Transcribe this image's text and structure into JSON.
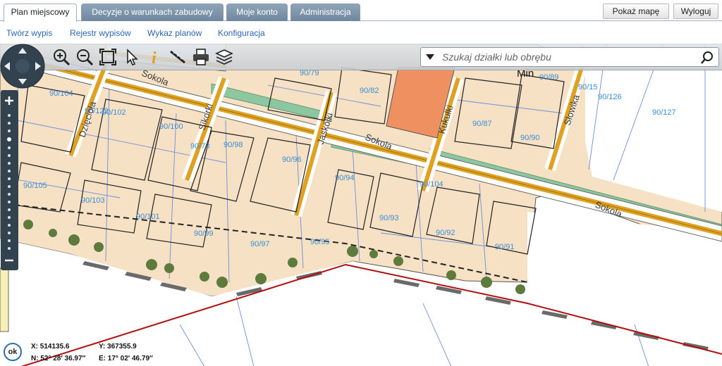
{
  "tabs": [
    {
      "label": "Plan miejscowy",
      "active": true
    },
    {
      "label": "Decyzje o warunkach zabudowy",
      "active": false
    },
    {
      "label": "Moje konto",
      "active": false
    },
    {
      "label": "Administracja",
      "active": false
    }
  ],
  "top_buttons": {
    "show_map": "Pokaż mapę",
    "logout": "Wyloguj"
  },
  "submenu": [
    "Twórz wypis",
    "Rejestr wypisów",
    "Wykaz planów",
    "Konfiguracja"
  ],
  "toolbar": {
    "tools": [
      "zoom-in-icon",
      "zoom-out-icon",
      "zoom-extent-icon",
      "pointer-icon",
      "info-icon",
      "measure-icon",
      "print-icon",
      "layers-icon"
    ],
    "search_placeholder": "Szukaj działki lub obrębu"
  },
  "map": {
    "parcels": [
      "90/104",
      "90/102",
      "90/100",
      "90/105",
      "90/103",
      "90/101",
      "90/99",
      "90/98",
      "90/97",
      "90/96",
      "90/95",
      "90/94",
      "90/93",
      "90/92",
      "90/91",
      "90/82",
      "90/79",
      "90/87",
      "90/89",
      "90/90",
      "90/126",
      "90/127",
      "90/104",
      "90/73",
      "90/15",
      "90/122"
    ],
    "streets": [
      "Sokola",
      "Sokola",
      "Sokola",
      "Dzięcioła",
      "Sikorki",
      "Jaskółki",
      "Kukułki",
      "Słowika",
      "Min"
    ],
    "colors": {
      "plot": "#f6e1c5",
      "road": "#e0a020",
      "green": "#8cc7a0",
      "service": "#ef9060",
      "boundary": "#b01010"
    }
  },
  "coordinates": {
    "x": "X: 514135.6",
    "y": "Y: 367355.9",
    "n": "N: 52° 28′ 36.97″",
    "e": "E: 17° 02′ 46.79″",
    "ok": "ok"
  }
}
